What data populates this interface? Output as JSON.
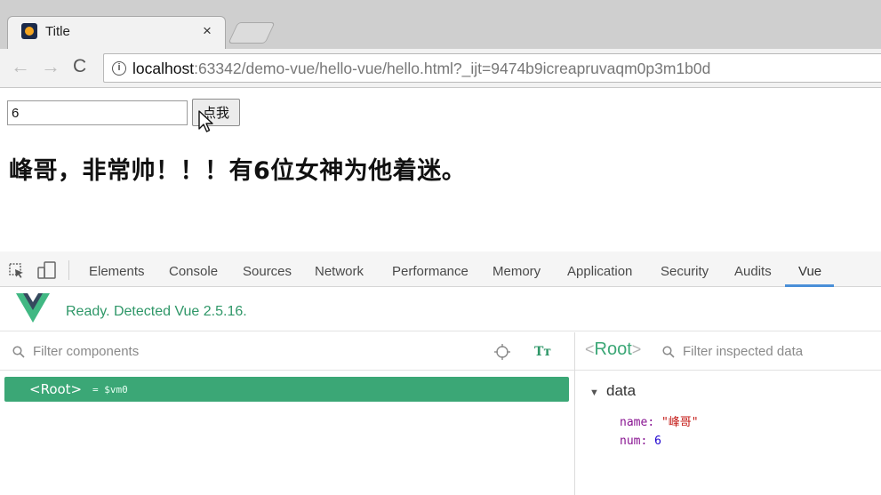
{
  "browser": {
    "tab_title": "Title",
    "tab_close": "×",
    "nav_back": "←",
    "nav_forward": "→",
    "nav_reload": "C",
    "info_icon_glyph": "i",
    "url_host": "localhost",
    "url_rest": ":63342/demo-vue/hello-vue/hello.html?_ijt=9474b9icreapruvaqm0p3m1b0d"
  },
  "page": {
    "input_value": "6",
    "button_label": "点我",
    "message": "峰哥，非常帅！！！有6位女神为他着迷。"
  },
  "devtools": {
    "tabs": [
      "Elements",
      "Console",
      "Sources",
      "Network",
      "Performance",
      "Memory",
      "Application",
      "Security",
      "Audits",
      "Vue"
    ],
    "active_tab": "Vue",
    "vue_status": "Ready. Detected Vue 2.5.16.",
    "components_filter_placeholder": "Filter components",
    "tt_glyph": "Tт",
    "root_component": "<Root>",
    "root_vm": "= $vm0",
    "inspected_root_open": "<",
    "inspected_root_name": "Root",
    "inspected_root_close": ">",
    "inspected_filter_placeholder": "Filter inspected data",
    "data_toggle": "▼",
    "data_section": "data",
    "props": [
      {
        "key": "name",
        "value": "\"峰哥\"",
        "type": "string"
      },
      {
        "key": "num",
        "value": "6",
        "type": "number"
      }
    ]
  },
  "colors": {
    "vue_green": "#3ba776",
    "active_tab_underline": "#4a8fd8",
    "prop_key": "#881391",
    "prop_string": "#c41a16",
    "prop_number": "#1c00cf"
  },
  "icons": [
    "app-favicon",
    "close-icon",
    "back-arrow-icon",
    "forward-arrow-icon",
    "reload-icon",
    "info-icon",
    "mouse-cursor-icon",
    "inspect-element-icon",
    "device-toolbar-icon",
    "vue-logo",
    "search-icon",
    "target-icon",
    "text-format-icon",
    "triangle-down-icon"
  ]
}
